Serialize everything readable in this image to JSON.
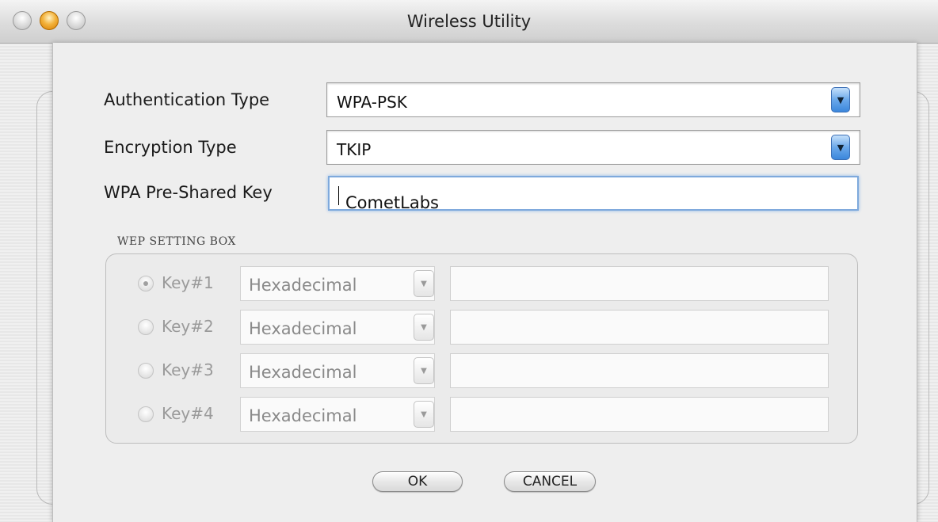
{
  "window": {
    "title": "Wireless Utility"
  },
  "form": {
    "auth_label": "Authentication Type",
    "auth_value": "WPA-PSK",
    "enc_label": "Encryption Type",
    "enc_value": "TKIP",
    "psk_label": "WPA Pre-Shared Key",
    "psk_value": "CometLabs"
  },
  "wep": {
    "title": "WEP SETTING BOX",
    "keys": [
      {
        "label": "Key#1",
        "format": "Hexadecimal",
        "value": "",
        "selected": true
      },
      {
        "label": "Key#2",
        "format": "Hexadecimal",
        "value": "",
        "selected": false
      },
      {
        "label": "Key#3",
        "format": "Hexadecimal",
        "value": "",
        "selected": false
      },
      {
        "label": "Key#4",
        "format": "Hexadecimal",
        "value": "",
        "selected": false
      }
    ]
  },
  "buttons": {
    "ok": "OK",
    "cancel": "CANCEL"
  },
  "colors": {
    "accent": "#6aa8ea",
    "focus_ring": "#7ea9dc",
    "sheet_bg": "#eeeeee"
  }
}
